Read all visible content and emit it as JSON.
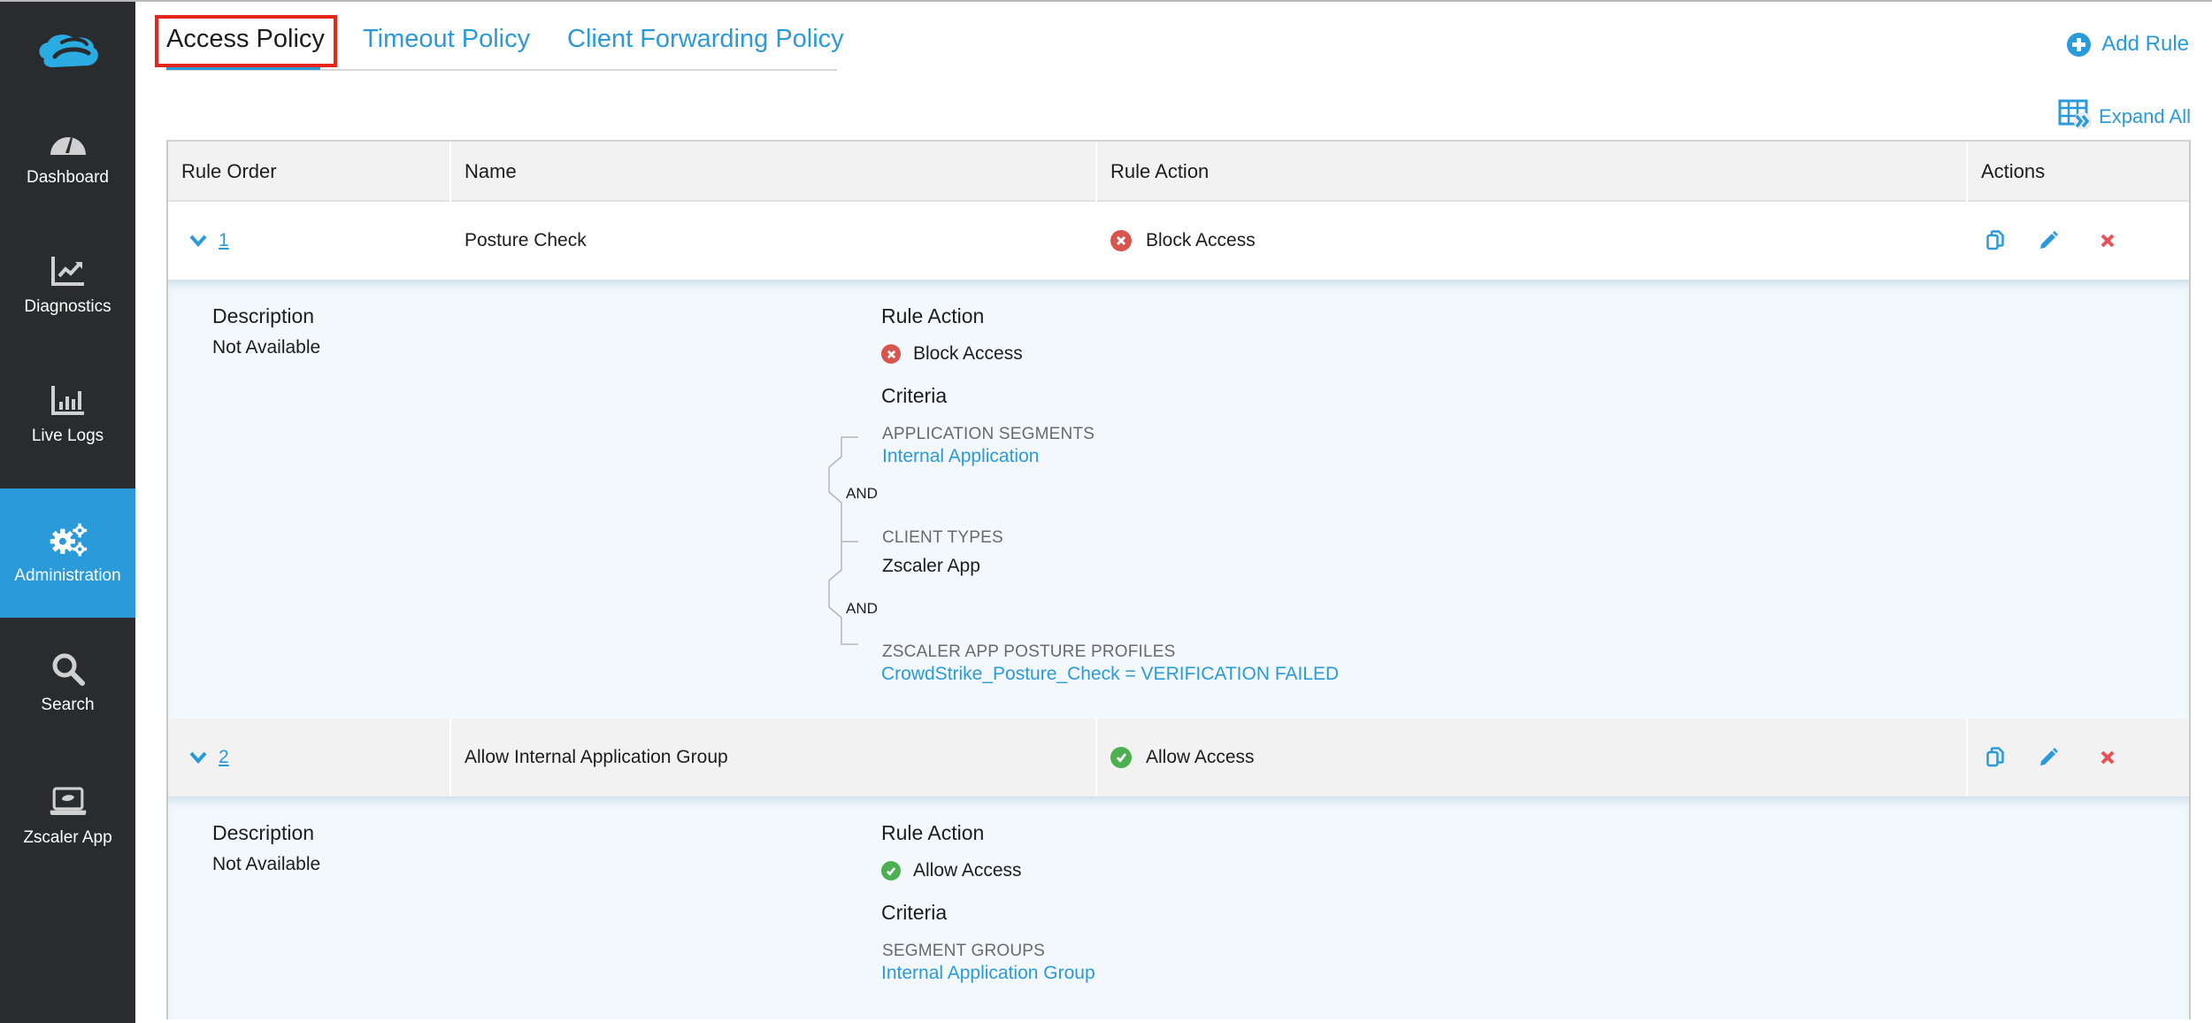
{
  "sidebar": {
    "logo": "zscaler-cloud-logo",
    "items": [
      {
        "label": "Dashboard",
        "icon": "gauge-icon",
        "active": false
      },
      {
        "label": "Diagnostics",
        "icon": "chart-line-icon",
        "active": false
      },
      {
        "label": "Live Logs",
        "icon": "bar-chart-icon",
        "active": false
      },
      {
        "label": "Administration",
        "icon": "gears-icon",
        "active": true
      },
      {
        "label": "Search",
        "icon": "search-icon",
        "active": false
      },
      {
        "label": "Zscaler App",
        "icon": "laptop-icon",
        "active": false
      }
    ]
  },
  "tabs": [
    {
      "label": "Access Policy",
      "active": true
    },
    {
      "label": "Timeout Policy",
      "active": false
    },
    {
      "label": "Client Forwarding Policy",
      "active": false
    }
  ],
  "toolbar": {
    "add_rule": "Add Rule",
    "expand_all": "Expand All"
  },
  "table": {
    "columns": [
      "Rule Order",
      "Name",
      "Rule Action",
      "Actions"
    ],
    "rows": [
      {
        "order": "1",
        "name": "Posture Check",
        "action": "Block Access",
        "action_type": "block",
        "expanded": true,
        "detail": {
          "description_label": "Description",
          "description": "Not Available",
          "rule_action_label": "Rule Action",
          "rule_action": "Block Access",
          "criteria_label": "Criteria",
          "criteria": [
            {
              "caption": "APPLICATION SEGMENTS",
              "value": "Internal Application",
              "is_link": true
            },
            {
              "caption": "CLIENT TYPES",
              "value": "Zscaler App",
              "is_link": false
            },
            {
              "caption": "ZSCALER APP POSTURE PROFILES",
              "value": "CrowdStrike_Posture_Check = VERIFICATION FAILED",
              "is_link": true
            }
          ],
          "operator": "AND"
        }
      },
      {
        "order": "2",
        "name": "Allow Internal Application Group",
        "action": "Allow Access",
        "action_type": "allow",
        "expanded": true,
        "detail": {
          "description_label": "Description",
          "description": "Not Available",
          "rule_action_label": "Rule Action",
          "rule_action": "Allow Access",
          "criteria_label": "Criteria",
          "criteria": [
            {
              "caption": "SEGMENT GROUPS",
              "value": "Internal Application Group",
              "is_link": true
            }
          ]
        }
      }
    ],
    "row_actions": [
      "copy-icon",
      "edit-pencil-icon",
      "delete-x-icon"
    ]
  },
  "colors": {
    "accent": "#2a9ad9",
    "sidebar_bg": "#2a2b2f",
    "block": "#d9534f",
    "allow": "#4caf50",
    "delete": "#e8505b",
    "highlight_box": "#e5271b"
  }
}
